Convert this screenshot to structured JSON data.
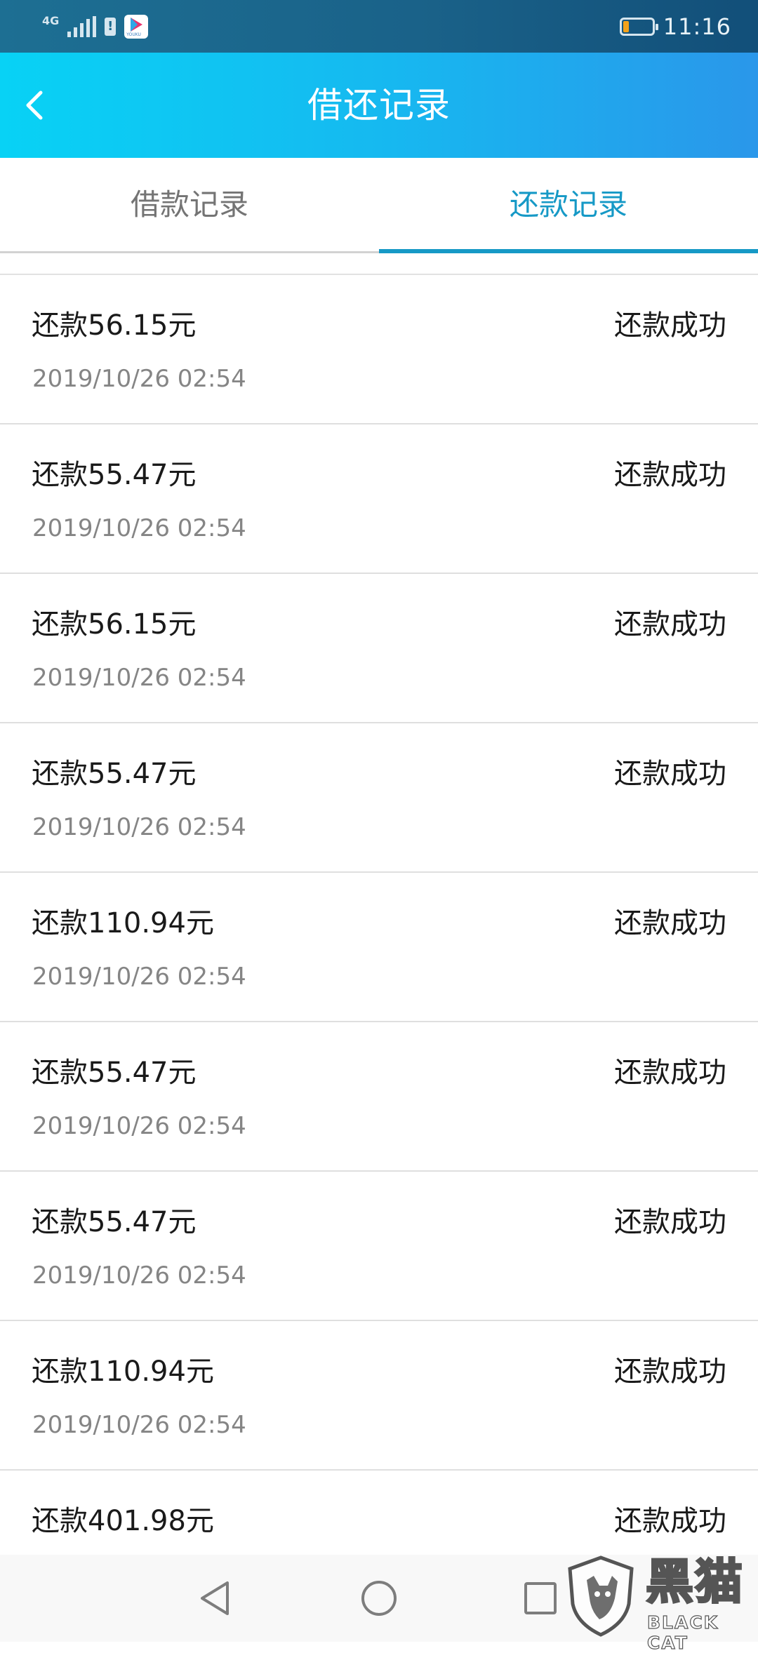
{
  "status_bar": {
    "network": "4G",
    "app_icon_text": "YOUKU",
    "battery_level": 0.2,
    "battery_color": "#f3a21a",
    "time": "11:16"
  },
  "header": {
    "back_icon": "chevron-left-icon",
    "title": "借还记录",
    "gradient": [
      "#08d2f5",
      "#2a97ea"
    ]
  },
  "tabs": [
    {
      "label": "借款记录",
      "active": false
    },
    {
      "label": "还款记录",
      "active": true
    }
  ],
  "accent_color": "#1699c6",
  "records": [
    {
      "amount": "还款56.15元",
      "time": "2019/10/26 02:54",
      "status": "还款成功"
    },
    {
      "amount": "还款55.47元",
      "time": "2019/10/26 02:54",
      "status": "还款成功"
    },
    {
      "amount": "还款56.15元",
      "time": "2019/10/26 02:54",
      "status": "还款成功"
    },
    {
      "amount": "还款55.47元",
      "time": "2019/10/26 02:54",
      "status": "还款成功"
    },
    {
      "amount": "还款110.94元",
      "time": "2019/10/26 02:54",
      "status": "还款成功"
    },
    {
      "amount": "还款55.47元",
      "time": "2019/10/26 02:54",
      "status": "还款成功"
    },
    {
      "amount": "还款55.47元",
      "time": "2019/10/26 02:54",
      "status": "还款成功"
    },
    {
      "amount": "还款110.94元",
      "time": "2019/10/26 02:54",
      "status": "还款成功"
    },
    {
      "amount": "还款401.98元",
      "time": "",
      "status": "还款成功"
    }
  ],
  "nav_bar": {
    "back_icon": "triangle-back-icon",
    "home_icon": "circle-home-icon",
    "recent_icon": "square-recent-icon"
  },
  "watermark": {
    "chinese": "黑猫",
    "english": "BLACK CAT"
  }
}
